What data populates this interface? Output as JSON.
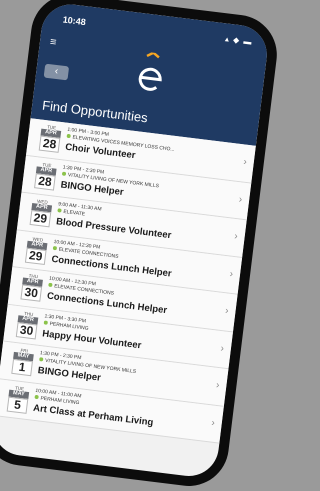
{
  "status": {
    "time": "10:48",
    "icons": "▴ ◆ ▬"
  },
  "header": {
    "title": "Find Opportunities",
    "back_label": "‹",
    "menu_icon": "≡"
  },
  "brand": {
    "logo_glyph": "e",
    "accent": "#f5a623",
    "header_color": "#1f3a63"
  },
  "events": [
    {
      "dow": "TUE",
      "mon": "APR",
      "day": "28",
      "time": "1:00 PM - 3:00 PM",
      "org": "ELEVATING VOICES MEMORY LOSS CHO...",
      "name": "Choir Volunteer"
    },
    {
      "dow": "TUE",
      "mon": "APR",
      "day": "28",
      "time": "1:30 PM - 2:30 PM",
      "org": "VITALITY LIVING OF NEW YORK MILLS",
      "name": "BINGO Helper"
    },
    {
      "dow": "WED",
      "mon": "APR",
      "day": "29",
      "time": "9:00 AM - 11:30 AM",
      "org": "ELEVATE",
      "name": "Blood Pressure Volunteer"
    },
    {
      "dow": "WED",
      "mon": "APR",
      "day": "29",
      "time": "10:00 AM - 12:30 PM",
      "org": "ELEVATE CONNECTIONS",
      "name": "Connections Lunch Helper"
    },
    {
      "dow": "THU",
      "mon": "APR",
      "day": "30",
      "time": "10:00 AM - 12:30 PM",
      "org": "ELEVATE CONNECTIONS",
      "name": "Connections Lunch Helper"
    },
    {
      "dow": "THU",
      "mon": "APR",
      "day": "30",
      "time": "1:30 PM - 3:30 PM",
      "org": "PERHAM LIVING",
      "name": "Happy Hour Volunteer"
    },
    {
      "dow": "FRI",
      "mon": "MAY",
      "day": "1",
      "time": "1:30 PM - 2:30 PM",
      "org": "VITALITY LIVING OF NEW YORK MILLS",
      "name": "BINGO Helper"
    },
    {
      "dow": "TUE",
      "mon": "MAY",
      "day": "5",
      "time": "10:00 AM - 11:00 AM",
      "org": "PERHAM LIVING",
      "name": "Art Class at Perham Living"
    }
  ]
}
